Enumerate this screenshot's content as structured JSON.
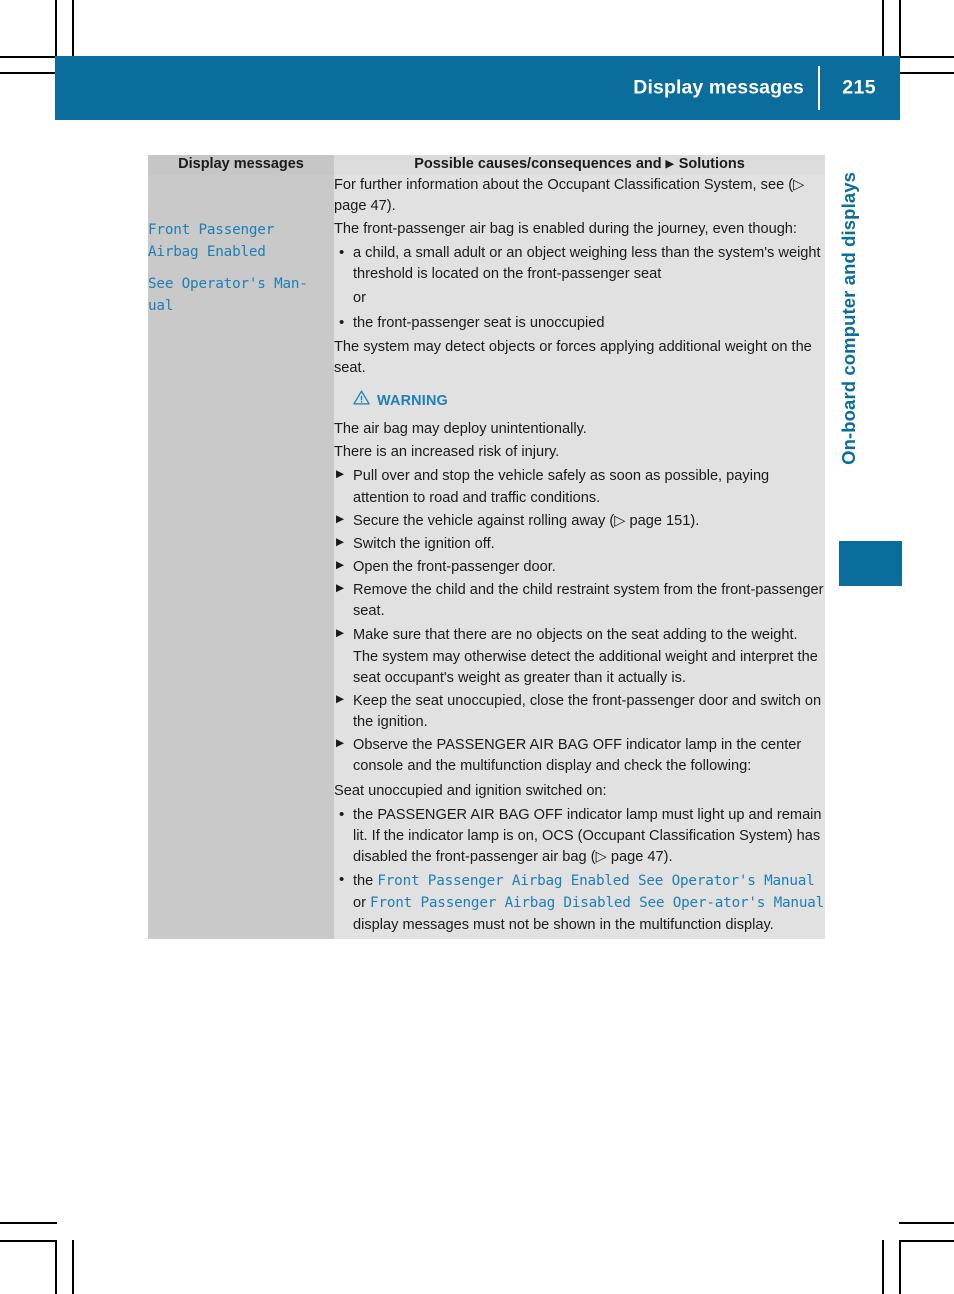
{
  "page": {
    "header_title": "Display messages",
    "page_number": "215",
    "side_tab_label": "On-board computer and displays",
    "accent_color": "#0a6d9c",
    "code_color": "#1d7fb5"
  },
  "table": {
    "headers": {
      "left": "Display messages",
      "right_before_marker": "Possible causes/consequences and",
      "right_marker": "▶",
      "right_after_marker": "Solutions"
    },
    "rows": [
      {
        "left_codes": [],
        "right": {
          "intro": "For further information about the Occupant Classification System, see (▷ page 47)."
        }
      },
      {
        "left_codes": [
          "Front Passenger\nAirbag Enabled",
          "See Operator's Man‑\nual"
        ],
        "right": {
          "lead": "The front-passenger air bag is enabled during the journey, even though:",
          "bullets_top": [
            "a child, a small adult or an object weighing less than the system's weight threshold is located on the front-passenger seat",
            "the front-passenger seat is unoccupied"
          ],
          "bullets_top_connector": "or",
          "after_bullets": "The system may detect objects or forces applying additional weight on the seat.",
          "warning_label": "WARNING",
          "warning_lines": [
            "The air bag may deploy unintentionally.",
            "There is an increased risk of injury."
          ],
          "steps": [
            {
              "text": "Pull over and stop the vehicle safely as soon as possible, paying attention to road and traffic conditions."
            },
            {
              "text": "Secure the vehicle against rolling away (▷ page 151)."
            },
            {
              "text": "Switch the ignition off."
            },
            {
              "text": "Open the front-passenger door."
            },
            {
              "text": "Remove the child and the child restraint system from the front-passenger seat."
            },
            {
              "text": "Make sure that there are no objects on the seat adding to the weight.",
              "note": "The system may otherwise detect the additional weight and interpret the seat occupant's weight as greater than it actually is."
            },
            {
              "text": "Keep the seat unoccupied, close the front-passenger door and switch on the ignition."
            },
            {
              "text": "Observe the PASSENGER AIR BAG OFF indicator lamp in the center console and the multifunction display and check the following:"
            }
          ],
          "check_intro": "Seat unoccupied and ignition switched on:",
          "check_bullet_1": "the PASSENGER AIR BAG OFF indicator lamp must light up and remain lit. If the indicator lamp is on, OCS (Occupant Classification System) has disabled the front-passenger air bag (▷ page 47).",
          "check_bullet_2": {
            "pre": "the",
            "code_1": "Front Passenger Airbag Enabled See Operator's Manual",
            "mid": "or",
            "code_2": "Front Passenger Airbag Disabled See Oper‑ator's Manual",
            "post": "display messages must not be shown in the multifunction display."
          }
        }
      }
    ]
  }
}
